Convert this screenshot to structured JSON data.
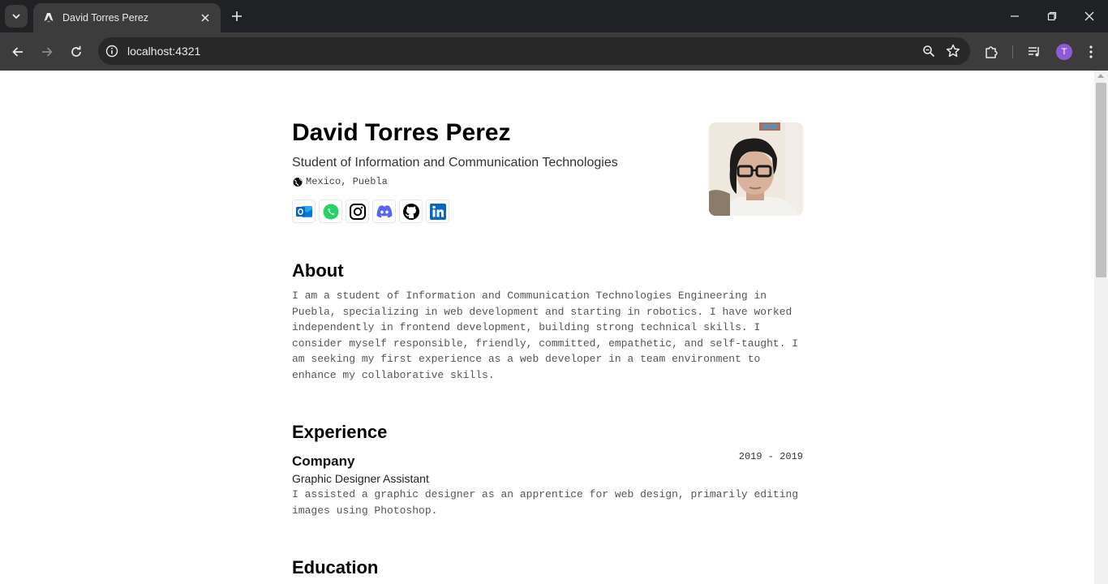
{
  "browser": {
    "tab_title": "David Torres Perez",
    "url": "localhost:4321",
    "profile_initial": "T"
  },
  "profile": {
    "name": "David Torres Perez",
    "subtitle": "Student of Information and Communication Technologies",
    "location": "Mexico, Puebla",
    "socials": [
      "outlook-icon",
      "whatsapp-icon",
      "instagram-icon",
      "discord-icon",
      "github-icon",
      "linkedin-icon"
    ]
  },
  "about": {
    "heading": "About",
    "text": "I am a student of Information and Communication Technologies Engineering in Puebla, specializing in web development and starting in robotics. I have worked independently in frontend development, building strong technical skills. I consider myself responsible, friendly, committed, empathetic, and self-taught. I am seeking my first experience as a web developer in a team environment to enhance my collaborative skills."
  },
  "experience": {
    "heading": "Experience",
    "items": [
      {
        "company": "Company",
        "dates": "2019 - 2019",
        "role": "Graphic Designer Assistant",
        "description": "I assisted a graphic designer as an apprentice for web design, primarily editing images using Photoshop."
      }
    ]
  },
  "education": {
    "heading": "Education"
  },
  "colors": {
    "chrome_dark": "#202124",
    "chrome_toolbar": "#3c3c3c",
    "outlook_blue": "#0a64c8",
    "whatsapp_green": "#25d366",
    "discord_blurple": "#5865f2",
    "linkedin_blue": "#0a66c2"
  }
}
